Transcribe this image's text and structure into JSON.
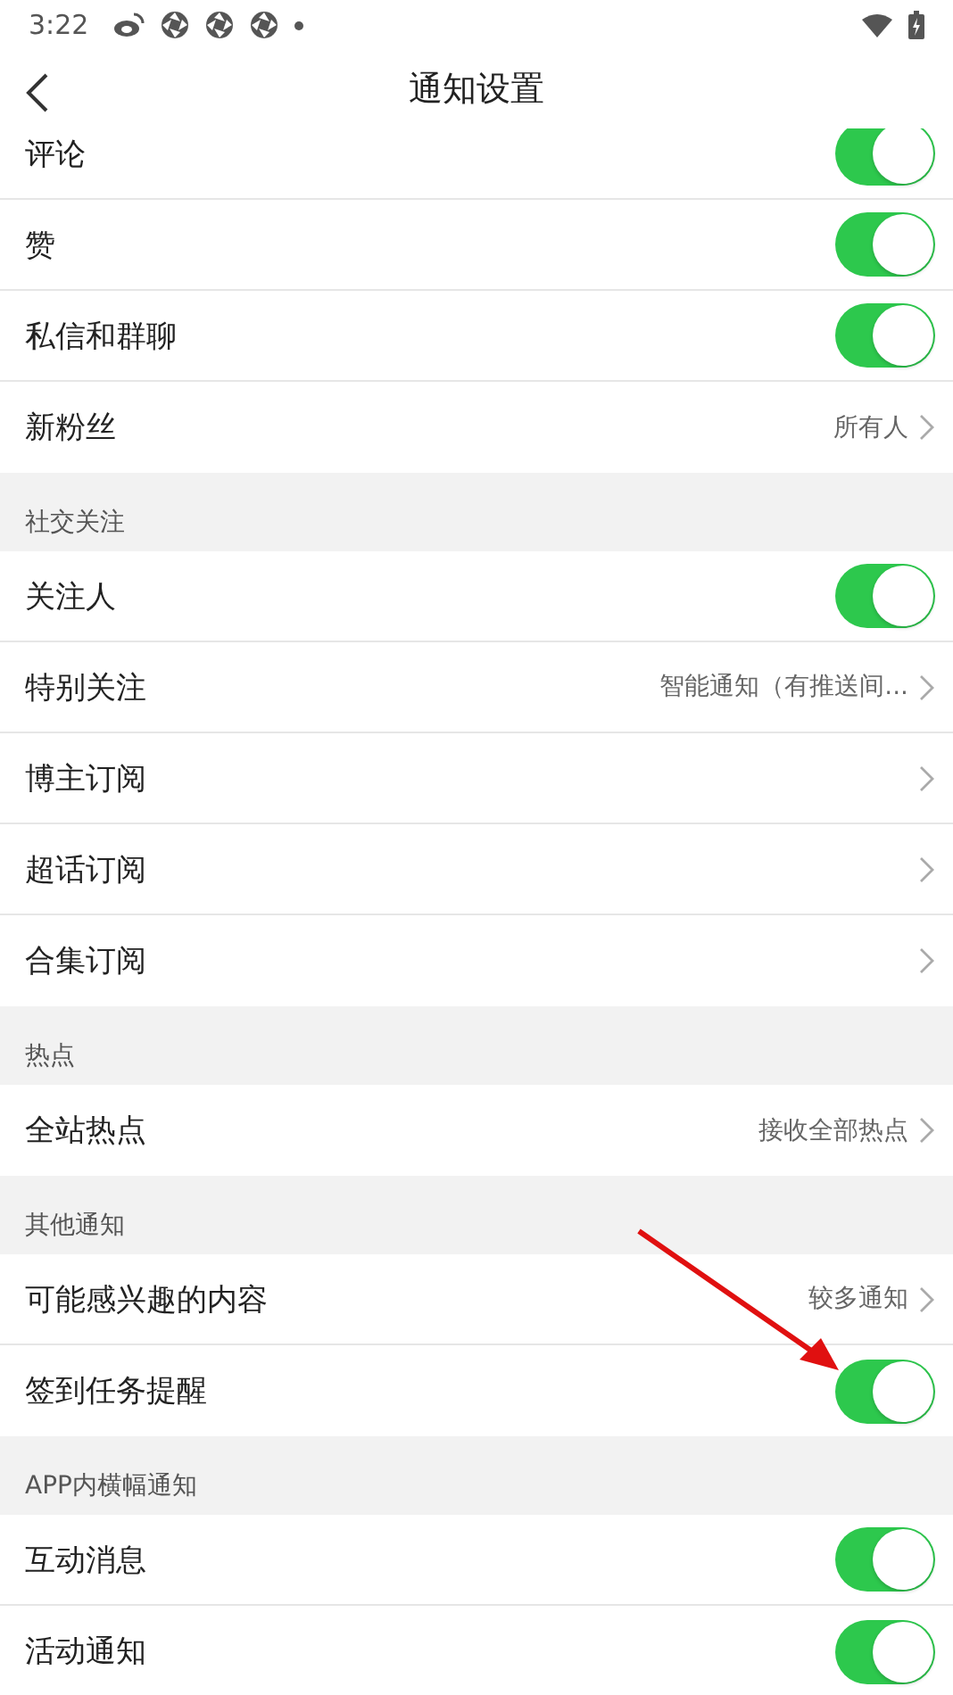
{
  "status_bar": {
    "time": "3:22"
  },
  "header": {
    "title": "通知设置"
  },
  "sections": [
    {
      "rows": [
        {
          "label": "评论",
          "kind": "toggle",
          "on": true
        },
        {
          "label": "赞",
          "kind": "toggle",
          "on": true
        },
        {
          "label": "私信和群聊",
          "kind": "toggle",
          "on": true
        },
        {
          "label": "新粉丝",
          "kind": "link",
          "value": "所有人"
        }
      ]
    },
    {
      "title": "社交关注",
      "rows": [
        {
          "label": "关注人",
          "kind": "toggle",
          "on": true
        },
        {
          "label": "特别关注",
          "kind": "link",
          "value": "智能通知（有推送间..."
        },
        {
          "label": "博主订阅",
          "kind": "link"
        },
        {
          "label": "超话订阅",
          "kind": "link"
        },
        {
          "label": "合集订阅",
          "kind": "link"
        }
      ]
    },
    {
      "title": "热点",
      "rows": [
        {
          "label": "全站热点",
          "kind": "link",
          "value": "接收全部热点"
        }
      ]
    },
    {
      "title": "其他通知",
      "rows": [
        {
          "label": "可能感兴趣的内容",
          "kind": "link",
          "value": "较多通知"
        },
        {
          "label": "签到任务提醒",
          "kind": "toggle",
          "on": true
        }
      ]
    },
    {
      "title": "APP内横幅通知",
      "rows": [
        {
          "label": "互动消息",
          "kind": "toggle",
          "on": true
        },
        {
          "label": "活动通知",
          "kind": "toggle",
          "on": true
        }
      ]
    }
  ]
}
